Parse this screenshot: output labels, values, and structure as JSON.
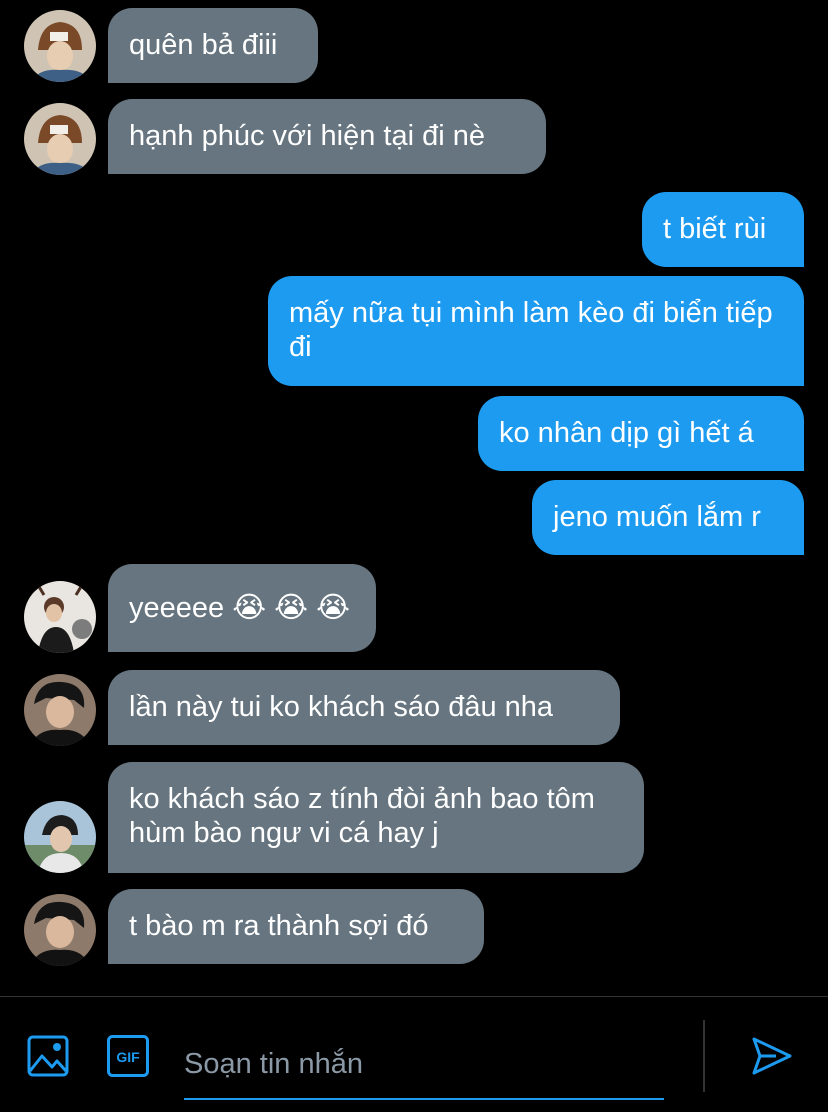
{
  "messages": [
    {
      "text": "quên bả điii"
    },
    {
      "text": "hạnh phúc với hiện tại đi nè"
    },
    {
      "text": "t biết rùi"
    },
    {
      "text": "mấy nữa tụi mình làm kèo đi biển tiếp đi"
    },
    {
      "text": "ko nhân dịp gì hết á"
    },
    {
      "text": "jeno muốn lắm r"
    },
    {
      "text": "yeeeee 😭 😭 😭"
    },
    {
      "text": "lần này tui ko khách sáo đâu nha"
    },
    {
      "text": "ko khách sáo z tính đòi ảnh bao tôm hùm bào ngư vi cá hay j"
    },
    {
      "text": "t bào m ra thành sợi đó"
    }
  ],
  "composer": {
    "placeholder": "Soạn tin nhắn",
    "gif_label": "GIF"
  },
  "colors": {
    "incoming_bubble": "#66757f",
    "outgoing_bubble": "#1d9bf0",
    "accent": "#1d9bf0",
    "background": "#000000"
  }
}
